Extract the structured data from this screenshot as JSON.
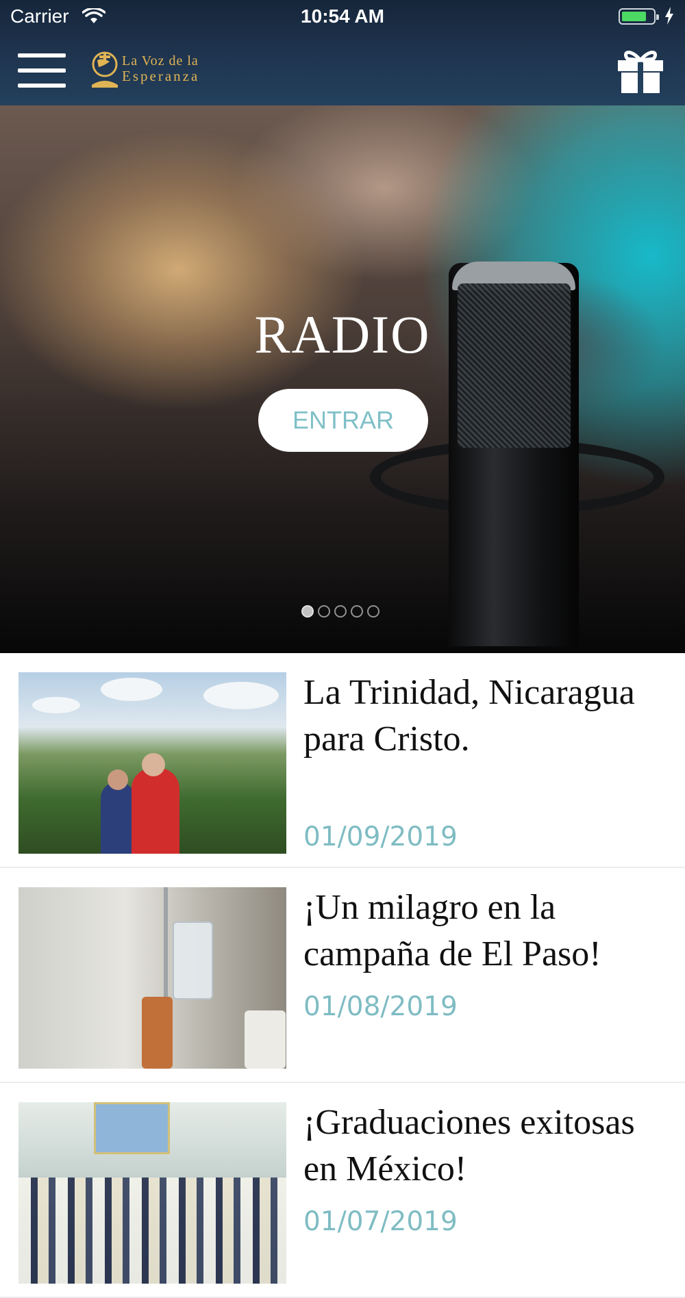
{
  "status_bar": {
    "carrier": "Carrier",
    "time": "10:54 AM",
    "battery_level": 0.8
  },
  "nav": {
    "logo_line1": "La Voz de la",
    "logo_line2": "Esperanza",
    "icons": [
      "hamburger-menu-icon",
      "gift-icon"
    ]
  },
  "hero": {
    "title": "RADIO",
    "button_label": "ENTRAR",
    "slide_count": 5,
    "active_slide": 1
  },
  "articles": [
    {
      "title": "La Trinidad, Nicaragua para Cristo.",
      "date": "01/09/2019"
    },
    {
      "title": "¡Un milagro en la campaña de El Paso!",
      "date": "01/08/2019"
    },
    {
      "title": "¡Graduaciones exitosas en México!",
      "date": "01/07/2019"
    }
  ],
  "colors": {
    "nav_bg": "#1f3550",
    "accent": "#7fbcc3",
    "logo_gold": "#e0b454"
  }
}
